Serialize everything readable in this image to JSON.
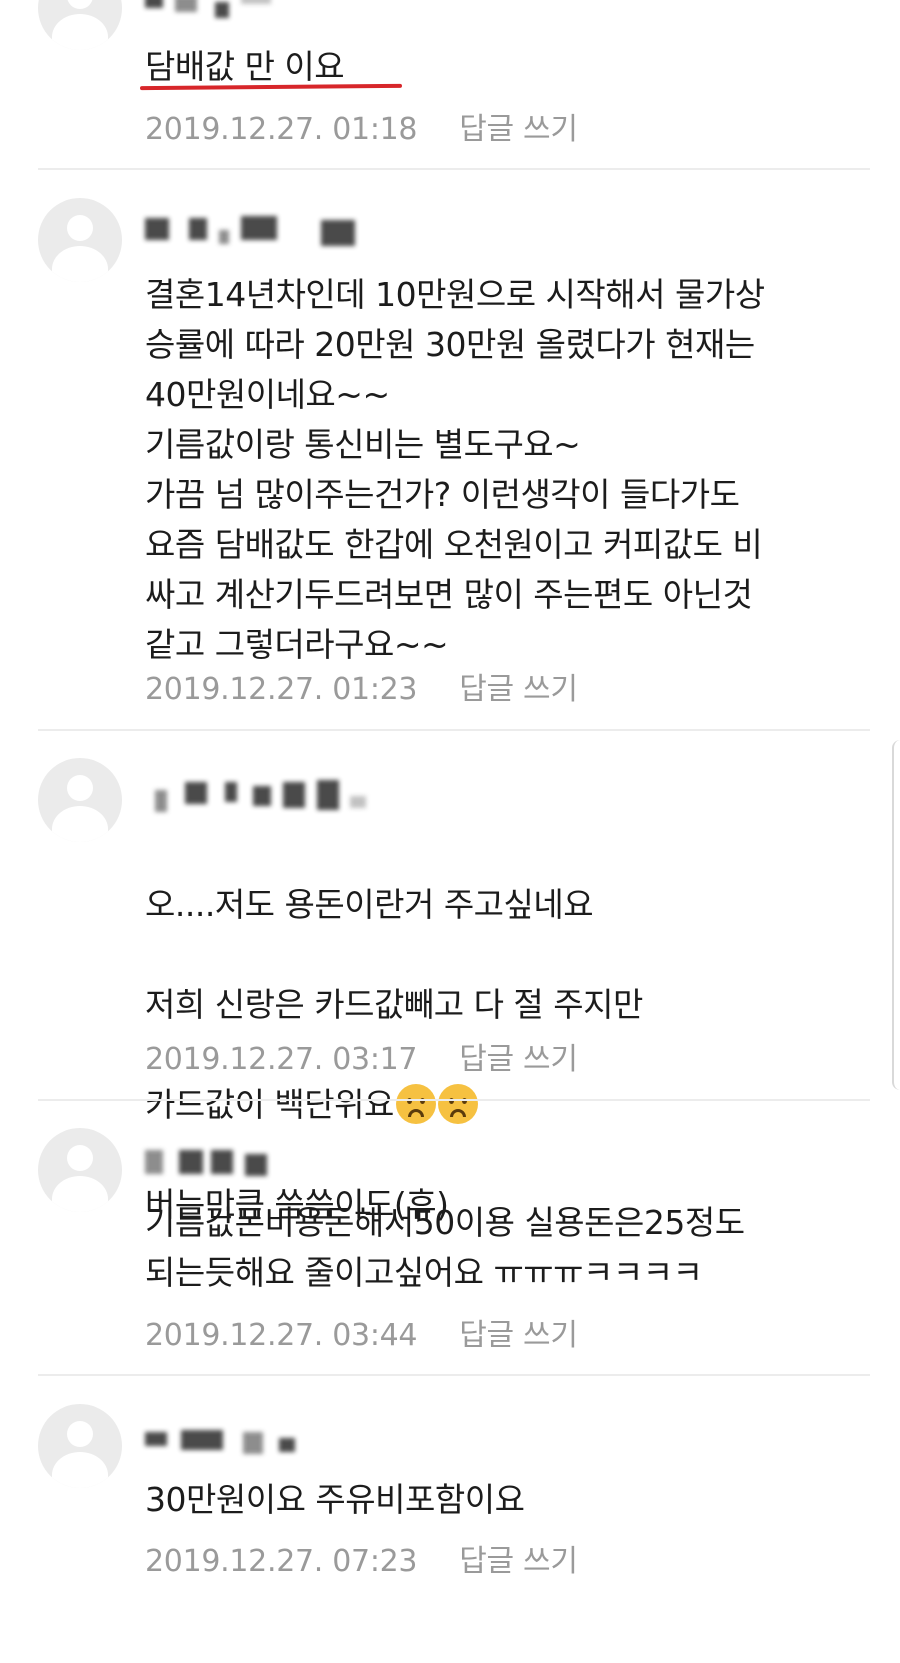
{
  "comments": [
    {
      "text": "담배값 만 이요",
      "date": "2019.12.27. 01:18",
      "reply": "답글 쓰기"
    },
    {
      "text": "결혼14년차인데 10만원으로 시작해서 물가상\n승률에 따라 20만원 30만원 올렸다가 현재는\n40만원이네요~~\n기름값이랑 통신비는 별도구요~\n가끔 넘 많이주는건가? 이런생각이 들다가도\n요즘 담배값도 한갑에 오천원이고 커피값도 비\n싸고 계산기두드려보면 많이 주는편도 아닌것\n같고 그렇더라구요~~",
      "date": "2019.12.27. 01:23",
      "reply": "답글 쓰기"
    },
    {
      "line1": "오....저도 용돈이란거 주고싶네요",
      "line2": "저희 신랑은 카드값빼고 다 절 주지만",
      "line3": "카드값이 백단위요",
      "line4": "버는만큼 씀씀이도(휴)",
      "emoji": "frowning-face-icon",
      "date": "2019.12.27. 03:17",
      "reply": "답글 쓰기"
    },
    {
      "text": "기름값폰비용돈해서50이용 실용돈은25정도\n되는듯해요 줄이고싶어요 ㅠㅠㅠㅋㅋㅋㅋ",
      "date": "2019.12.27. 03:44",
      "reply": "답글 쓰기"
    },
    {
      "text": "30만원이요 주유비포함이요",
      "date": "2019.12.27. 07:23",
      "reply": "답글 쓰기"
    }
  ],
  "colors": {
    "underline": "#d7262a",
    "meta": "#9a9a9a",
    "divider": "#ececec",
    "avatar": "#ebebeb"
  }
}
